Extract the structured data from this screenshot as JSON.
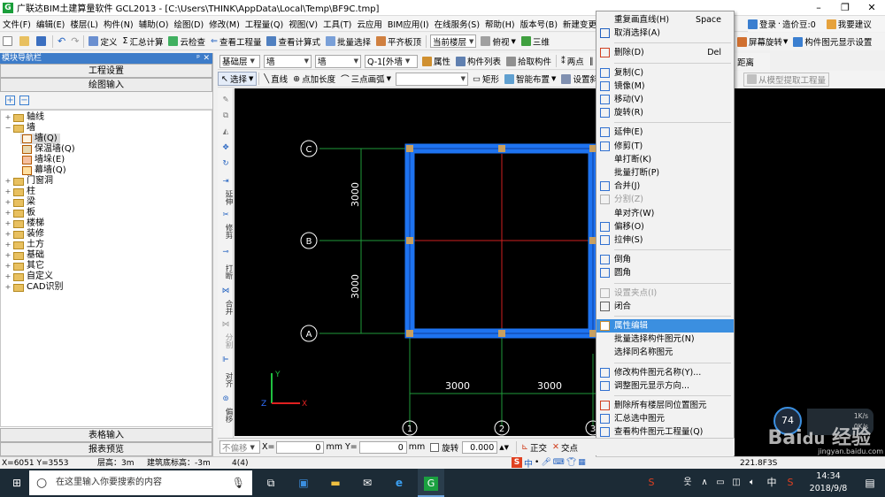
{
  "window": {
    "title": "广联达BIM土建算量软件 GCL2013 - [C:\\Users\\THINK\\AppData\\Local\\Temp\\BF9C.tmp]",
    "minimize": "–",
    "restore": "❐",
    "close": "✕"
  },
  "menu": [
    "文件(F)",
    "编辑(E)",
    "楼层(L)",
    "构件(N)",
    "辅助(O)",
    "绘图(D)",
    "修改(M)",
    "工程量(Q)",
    "视图(V)",
    "工具(T)",
    "云应用",
    "BIM应用(I)",
    "在线服务(S)",
    "帮助(H)",
    "版本号(B)",
    "新建变更"
  ],
  "right_top": {
    "login": "登录",
    "price": "造价豆:0",
    "ask": "我要建议"
  },
  "toolbar1": {
    "define": "定义",
    "summary": "汇总计算",
    "cloud_check": "云检查",
    "find_qty": "查看工程量",
    "view_formula": "查看计算式",
    "batch_select": "批量选择",
    "flat_slab": "平齐板顶",
    "floor_combo": "当前楼层",
    "view_combo": "俯视",
    "three_d": "三维",
    "screen_rotate": "屏幕旋转",
    "display_settings": "构件图元显示设置"
  },
  "toolbar2": {
    "layer": "基础层",
    "type1": "墙",
    "type2": "墙",
    "comp": "Q-1[外墙",
    "props": "属性",
    "comp_list": "构件列表",
    "pick": "拾取构件",
    "two_pts": "两点",
    "parallel": "平",
    "distance": "距离"
  },
  "toolbar3": {
    "select": "选择",
    "line": "直线",
    "add_len": "点加长度",
    "arc": "三点画弧",
    "rect": "矩形",
    "smart": "智能布置",
    "slope": "设置斜墙",
    "extract": "从模型提取工程量"
  },
  "nav": {
    "title": "模块导航栏",
    "pin": "ᵖ",
    "close": "✕",
    "project_settings": "工程设置",
    "drawing_input": "绘图输入",
    "table_input": "表格输入",
    "report_preview": "报表预览",
    "tree": [
      {
        "label": "轴线",
        "level": 0,
        "exp": "+"
      },
      {
        "label": "墙",
        "level": 0,
        "exp": "−"
      },
      {
        "label": "墙(Q)",
        "level": 1,
        "exp": ""
      },
      {
        "label": "保温墙(Q)",
        "level": 1,
        "exp": ""
      },
      {
        "label": "墙垛(E)",
        "level": 1,
        "exp": ""
      },
      {
        "label": "幕墙(Q)",
        "level": 1,
        "exp": ""
      },
      {
        "label": "门窗洞",
        "level": 0,
        "exp": "+"
      },
      {
        "label": "柱",
        "level": 0,
        "exp": "+"
      },
      {
        "label": "梁",
        "level": 0,
        "exp": "+"
      },
      {
        "label": "板",
        "level": 0,
        "exp": "+"
      },
      {
        "label": "楼梯",
        "level": 0,
        "exp": "+"
      },
      {
        "label": "装修",
        "level": 0,
        "exp": "+"
      },
      {
        "label": "土方",
        "level": 0,
        "exp": "+"
      },
      {
        "label": "基础",
        "level": 0,
        "exp": "+"
      },
      {
        "label": "其它",
        "level": 0,
        "exp": "+"
      },
      {
        "label": "自定义",
        "level": 0,
        "exp": "+"
      },
      {
        "label": "CAD识别",
        "level": 0,
        "exp": "+"
      }
    ]
  },
  "vtools": [
    "延伸",
    "修剪",
    "打断",
    "合并",
    "分割",
    "对齐",
    "偏移"
  ],
  "canvas": {
    "axes_rows": [
      "C",
      "B",
      "A"
    ],
    "axes_cols": [
      "1",
      "2",
      "3"
    ],
    "dim_v": [
      "3000",
      "3000"
    ],
    "dim_h": [
      "3000",
      "3000"
    ],
    "axis_x": "X",
    "axis_y": "Y",
    "axis_z": "Z"
  },
  "context_menu": [
    {
      "label": "重复画直线(H)",
      "shortcut": "Space",
      "icon": "none",
      "state": "normal"
    },
    {
      "label": "取消选择(A)",
      "shortcut": "",
      "icon": "undo-icon",
      "state": "normal"
    },
    {
      "label": "sep"
    },
    {
      "label": "删除(D)",
      "shortcut": "Del",
      "icon": "delete-icon",
      "state": "normal"
    },
    {
      "label": "sep"
    },
    {
      "label": "复制(C)",
      "shortcut": "",
      "icon": "copy-icon",
      "state": "normal"
    },
    {
      "label": "镜像(M)",
      "shortcut": "",
      "icon": "mirror-icon",
      "state": "normal"
    },
    {
      "label": "移动(V)",
      "shortcut": "",
      "icon": "move-icon",
      "state": "normal"
    },
    {
      "label": "旋转(R)",
      "shortcut": "",
      "icon": "rotate-icon",
      "state": "normal"
    },
    {
      "label": "sep"
    },
    {
      "label": "延伸(E)",
      "shortcut": "",
      "icon": "extend-icon",
      "state": "normal"
    },
    {
      "label": "修剪(T)",
      "shortcut": "",
      "icon": "trim-icon",
      "state": "normal"
    },
    {
      "label": "单打断(K)",
      "shortcut": "",
      "icon": "none",
      "state": "normal"
    },
    {
      "label": "批量打断(P)",
      "shortcut": "",
      "icon": "none",
      "state": "normal"
    },
    {
      "label": "合并(J)",
      "shortcut": "",
      "icon": "merge-icon",
      "state": "normal"
    },
    {
      "label": "分割(Z)",
      "shortcut": "",
      "icon": "split-icon",
      "state": "disabled"
    },
    {
      "label": "单对齐(W)",
      "shortcut": "",
      "icon": "none",
      "state": "normal"
    },
    {
      "label": "偏移(O)",
      "shortcut": "",
      "icon": "offset-icon",
      "state": "normal"
    },
    {
      "label": "拉伸(S)",
      "shortcut": "",
      "icon": "stretch-icon",
      "state": "normal"
    },
    {
      "label": "sep"
    },
    {
      "label": "倒角",
      "shortcut": "",
      "icon": "chamfer-icon",
      "state": "normal"
    },
    {
      "label": "圆角",
      "shortcut": "",
      "icon": "fillet-icon",
      "state": "normal"
    },
    {
      "label": "sep"
    },
    {
      "label": "设置夹点(I)",
      "shortcut": "",
      "icon": "grip-icon",
      "state": "disabled"
    },
    {
      "label": "闭合",
      "shortcut": "",
      "icon": "close-shape-icon",
      "state": "normal"
    },
    {
      "label": "sep"
    },
    {
      "label": "属性编辑",
      "shortcut": "",
      "icon": "property-icon",
      "state": "selected"
    },
    {
      "label": "批量选择构件图元(N)",
      "shortcut": "",
      "icon": "none",
      "state": "normal"
    },
    {
      "label": "选择同名称图元",
      "shortcut": "",
      "icon": "none",
      "state": "normal"
    },
    {
      "label": "sep"
    },
    {
      "label": "修改构件图元名称(Y)...",
      "shortcut": "",
      "icon": "rename-icon",
      "state": "normal"
    },
    {
      "label": "调整图元显示方向...",
      "shortcut": "",
      "icon": "direction-icon",
      "state": "normal"
    },
    {
      "label": "sep"
    },
    {
      "label": "删除所有楼层同位置图元",
      "shortcut": "",
      "icon": "delete-all-icon",
      "state": "normal"
    },
    {
      "label": "汇总选中图元",
      "shortcut": "",
      "icon": "summary-icon",
      "state": "normal"
    },
    {
      "label": "查看构件图元工程量(Q)",
      "shortcut": "",
      "icon": "view-qty-icon",
      "state": "normal"
    },
    {
      "label": "查看构件图元工程量计算式(F)",
      "shortcut": "",
      "icon": "none",
      "state": "normal"
    }
  ],
  "coordbar": {
    "mode": "不偏移",
    "x_label": "X=",
    "x_val": "0",
    "mm1": "mm",
    "y_label": "Y=",
    "y_val": "0",
    "mm2": "mm",
    "rotate": "旋转",
    "rot_val": "0.000",
    "ortho": "正交",
    "intersect": "交点"
  },
  "statusbar": {
    "xy": "X=6051  Y=3553",
    "floor_h": "层高：3m",
    "base_elev": "建筑底标高：-3m",
    "count": "4(4)",
    "scale": "221.8F3S"
  },
  "taskbar": {
    "search_placeholder": "在这里输入你要搜索的内容",
    "time": "14:34",
    "date": "2018/9/8",
    "ime": "中",
    "watermark": "jingyan.baidu.com",
    "badge": "74",
    "net_up": "1K/s",
    "net_down": "0K/s"
  }
}
